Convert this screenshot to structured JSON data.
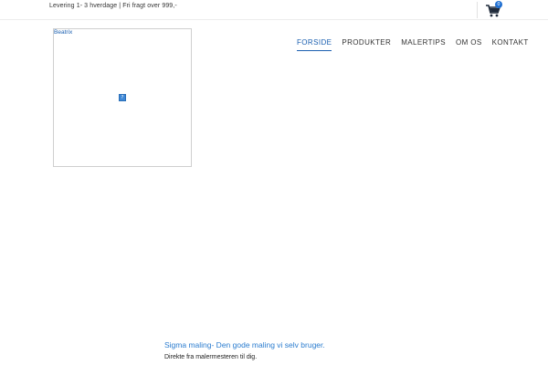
{
  "topbar": {
    "info_text": "Levering 1- 3 hverdage | Fri fragt over 999,-",
    "cart_count": "0"
  },
  "logo": {
    "alt_text": "Beatrix",
    "broken_image_glyph": "?"
  },
  "nav": {
    "items": [
      {
        "label": "FORSIDE",
        "active": true
      },
      {
        "label": "PRODUKTER",
        "active": false
      },
      {
        "label": "MALERTIPS",
        "active": false
      },
      {
        "label": "OM OS",
        "active": false
      },
      {
        "label": "KONTAKT",
        "active": false
      }
    ]
  },
  "hero": {
    "tagline": "Sigma maling- Den gode maling vi selv bruger.",
    "subline": "Direkte fra malermesteren til dig."
  },
  "colors": {
    "accent": "#1a5fb0",
    "tagline": "#2a7ccf",
    "badge": "#1f6fd1",
    "text": "#222222"
  }
}
